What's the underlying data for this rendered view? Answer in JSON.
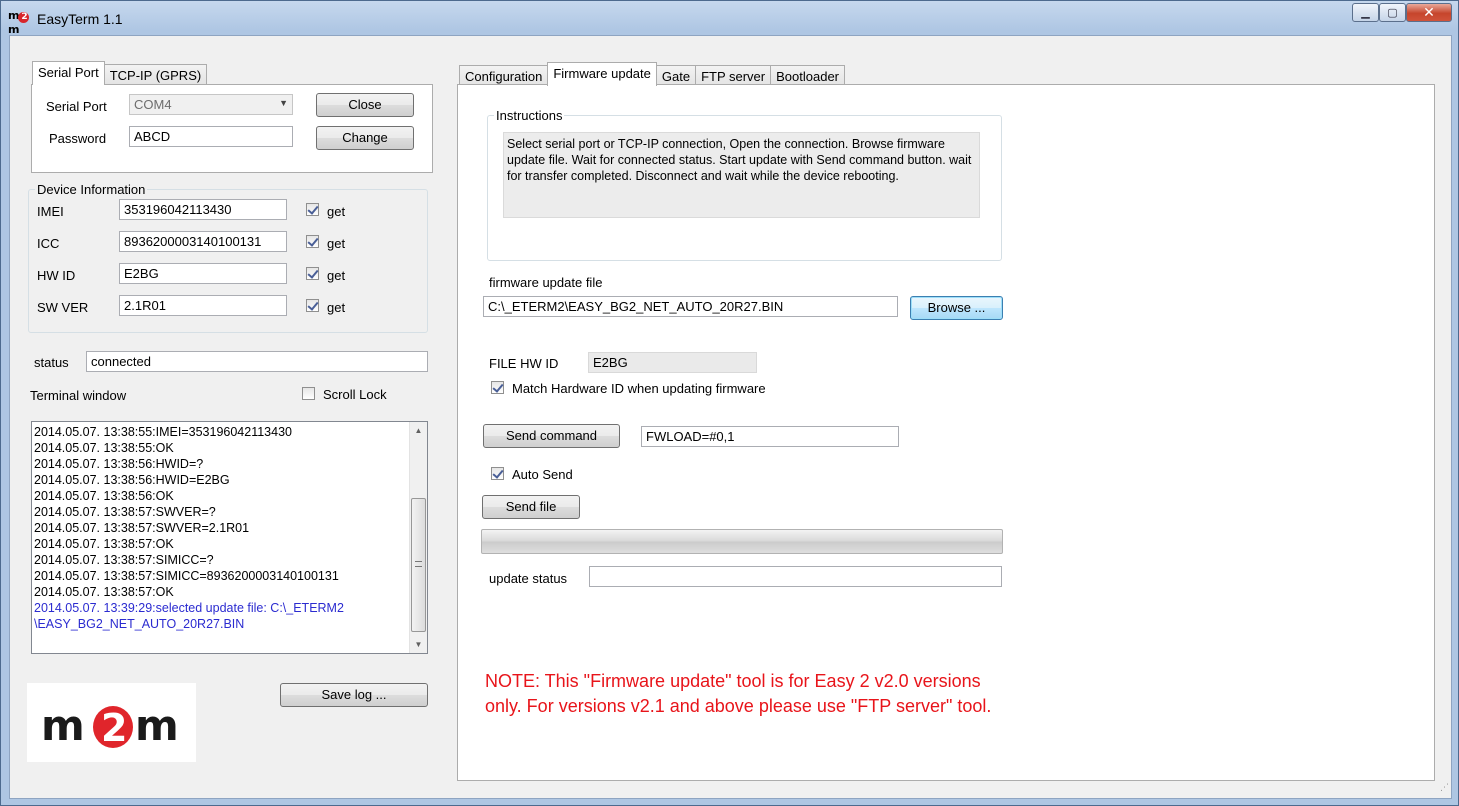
{
  "window": {
    "title": "EasyTerm 1.1"
  },
  "left_tabs": [
    "Serial Port",
    "TCP-IP (GPRS)"
  ],
  "serial": {
    "port_label": "Serial Port",
    "port_value": "COM4",
    "password_label": "Password",
    "password_value": "ABCD",
    "close_label": "Close",
    "change_label": "Change"
  },
  "device_info": {
    "title": "Device Information",
    "get_label": "get",
    "rows": [
      {
        "label": "IMEI",
        "value": "353196042113430",
        "checked": true
      },
      {
        "label": "ICC",
        "value": "8936200003140100131",
        "checked": true
      },
      {
        "label": "HW ID",
        "value": "E2BG",
        "checked": true
      },
      {
        "label": "SW VER",
        "value": "2.1R01",
        "checked": true
      }
    ]
  },
  "status": {
    "label": "status",
    "value": "connected"
  },
  "terminal": {
    "label": "Terminal window",
    "scroll_lock_label": "Scroll Lock",
    "lines": [
      "2014.05.07. 13:38:55:IMEI=353196042113430",
      "2014.05.07. 13:38:55:OK",
      "2014.05.07. 13:38:56:HWID=?",
      "2014.05.07. 13:38:56:HWID=E2BG",
      "2014.05.07. 13:38:56:OK",
      "2014.05.07. 13:38:57:SWVER=?",
      "2014.05.07. 13:38:57:SWVER=2.1R01",
      "2014.05.07. 13:38:57:OK",
      "2014.05.07. 13:38:57:SIMICC=?",
      "2014.05.07. 13:38:57:SIMICC=8936200003140100131",
      "2014.05.07. 13:38:57:OK"
    ],
    "last_line": "2014.05.07. 13:39:29:selected update file: C:\\_ETERM2 \\EASY_BG2_NET_AUTO_20R27.BIN"
  },
  "save_log_label": "Save log ...",
  "logo": {
    "text_left": "m",
    "text_mid": "2",
    "text_right": "m",
    "brand_color": "#e0252b"
  },
  "right_tabs": [
    "Configuration",
    "Firmware update",
    "Gate",
    "FTP server",
    "Bootloader"
  ],
  "firmware": {
    "instructions_title": "Instructions",
    "instructions_text": "Select serial port or TCP-IP connection,  Open the connection. Browse firmware update file. Wait for connected status. Start update with Send command button. wait for transfer completed. Disconnect and wait while the device rebooting.",
    "file_label": "firmware update file",
    "file_value": "C:\\_ETERM2\\EASY_BG2_NET_AUTO_20R27.BIN",
    "browse_label": "Browse ...",
    "file_hwid_label": "FILE HW ID",
    "file_hwid_value": "E2BG",
    "match_hwid_label": "Match Hardware ID when updating firmware",
    "send_command_label": "Send command",
    "command_value": "FWLOAD=#0,1",
    "auto_send_label": "Auto Send",
    "send_file_label": "Send file",
    "update_status_label": "update status",
    "update_status_value": "",
    "note": "NOTE: This \"Firmware update\" tool is for Easy 2 v2.0 versions only. For versions v2.1 and above please use \"FTP server\" tool.",
    "note_color": "#e8141a"
  }
}
